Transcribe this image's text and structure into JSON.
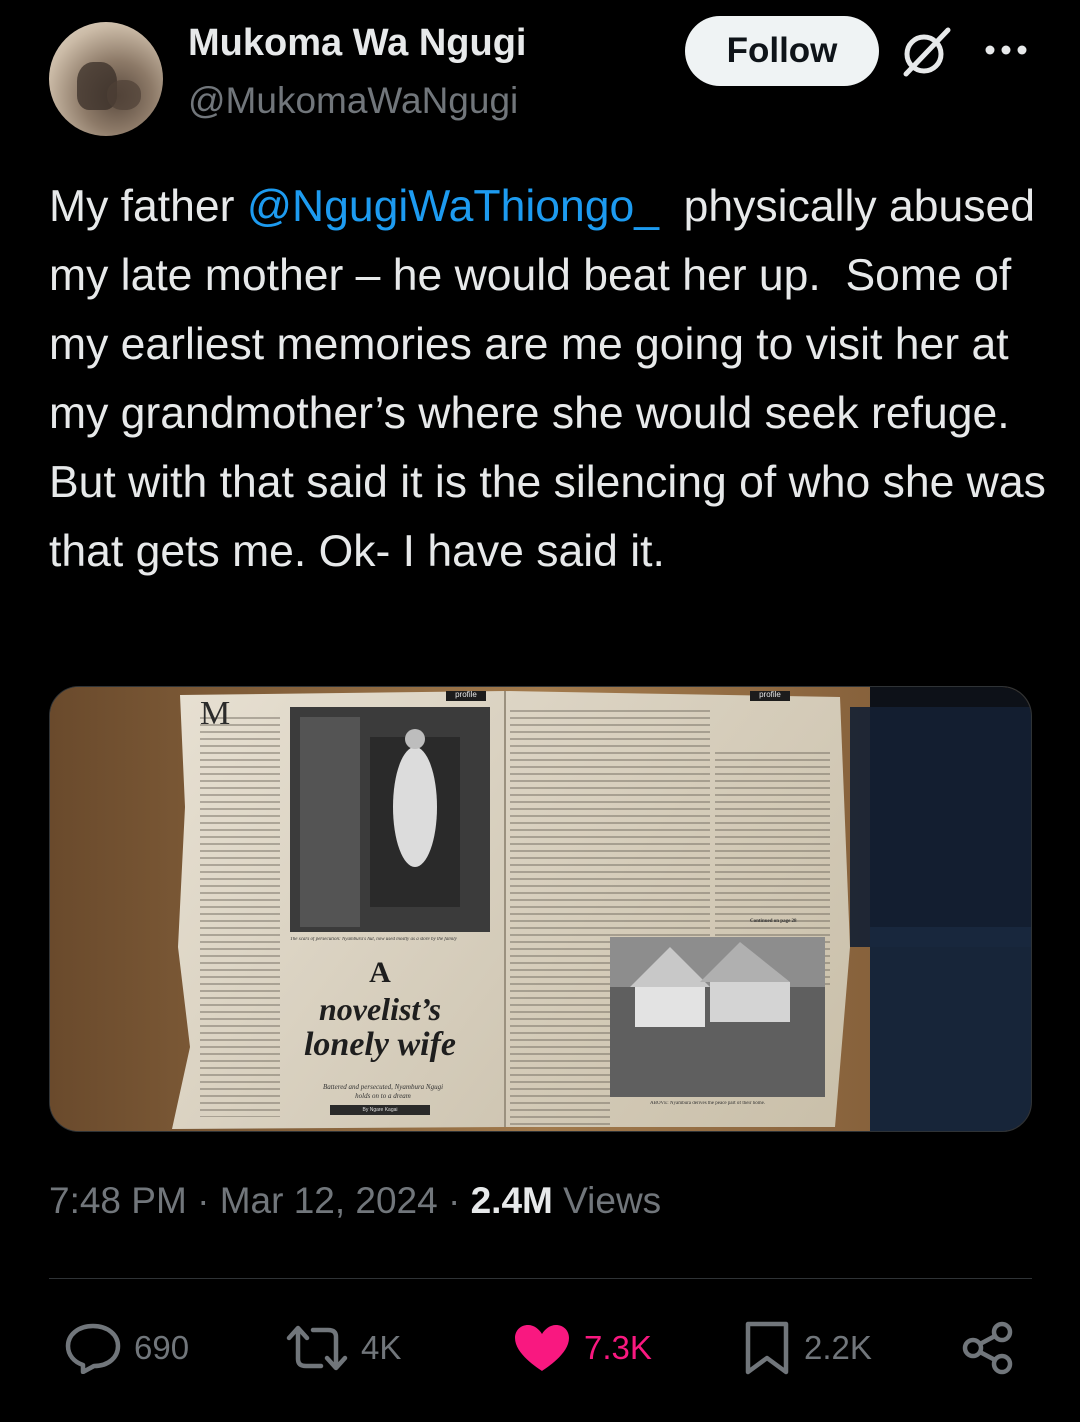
{
  "author": {
    "display_name": "Mukoma Wa Ngugi",
    "handle": "@MukomaWaNgugi",
    "avatar_icon": "profile-photo"
  },
  "header": {
    "follow_label": "Follow",
    "grok_icon": "grok-icon",
    "more_icon": "more-options-icon"
  },
  "tweet": {
    "text_before_mention": "My father ",
    "mention": "@NgugiWaThiongo_",
    "text_after_mention": "  physically abused my late mother – he would beat her up.  Some of my earliest memories are me going to visit her at my grandmother’s where she would seek refuge. But with that said it is the silencing of who she was that gets me. Ok- I have said it."
  },
  "media": {
    "left_page": {
      "drop_cap": "M",
      "photo_caption": "The scars of persecution: Nyambura's hut, now used mostly as a store by the family",
      "headline_line1": "A",
      "headline_line2": "novelist’s",
      "headline_line3": "lonely wife",
      "subhead_line1": "Battered and persecuted, Nyambura Ngugi",
      "subhead_line2": "holds on to a dream",
      "byline": "By Ngare Kagai",
      "tag": "profile"
    },
    "right_page": {
      "tag": "profile",
      "photo_caption": "ABOVE: Nyambura derives the peace part of their home.",
      "continued": "Continued on page 28"
    }
  },
  "meta": {
    "time": "7:48 PM",
    "separator": " · ",
    "date": "Mar 12, 2024",
    "views_count": "2.4M",
    "views_label": " Views"
  },
  "actions": {
    "replies": "690",
    "reposts": "4K",
    "likes": "7.3K",
    "bookmarks": "2.2K",
    "like_color": "#f91880",
    "accent_color": "#1d9bf0"
  }
}
